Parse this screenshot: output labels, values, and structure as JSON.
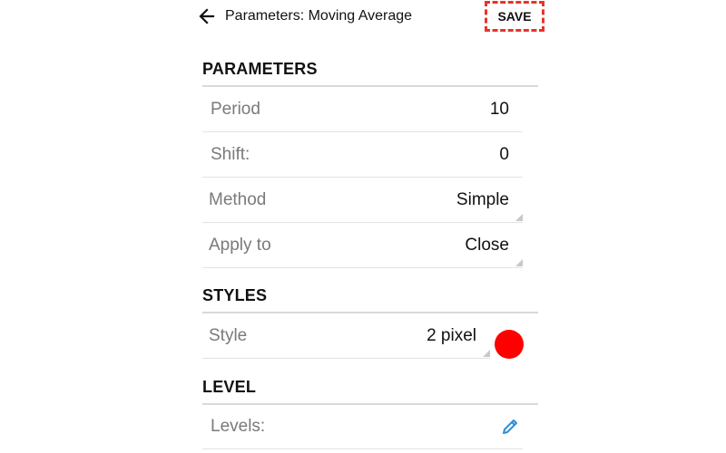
{
  "header": {
    "title": "Parameters: Moving Average",
    "save_label": "SAVE",
    "back_icon": "arrow-left-icon"
  },
  "sections": {
    "parameters": {
      "heading": "PARAMETERS",
      "rows": [
        {
          "label": "Period",
          "value": "10"
        },
        {
          "label": "Shift:",
          "value": "0"
        },
        {
          "label": "Method",
          "value": "Simple"
        },
        {
          "label": "Apply to",
          "value": "Close"
        }
      ]
    },
    "styles": {
      "heading": "STYLES",
      "style": {
        "label": "Style",
        "value": "2 pixel",
        "color": "#ff0000"
      }
    },
    "level": {
      "heading": "LEVEL",
      "levels": {
        "label": "Levels:",
        "edit_icon": "pencil-icon"
      }
    }
  },
  "colors": {
    "accent_blue": "#2a8fd6",
    "highlight_red": "#e8332a",
    "label_gray": "#7a7a7a"
  }
}
